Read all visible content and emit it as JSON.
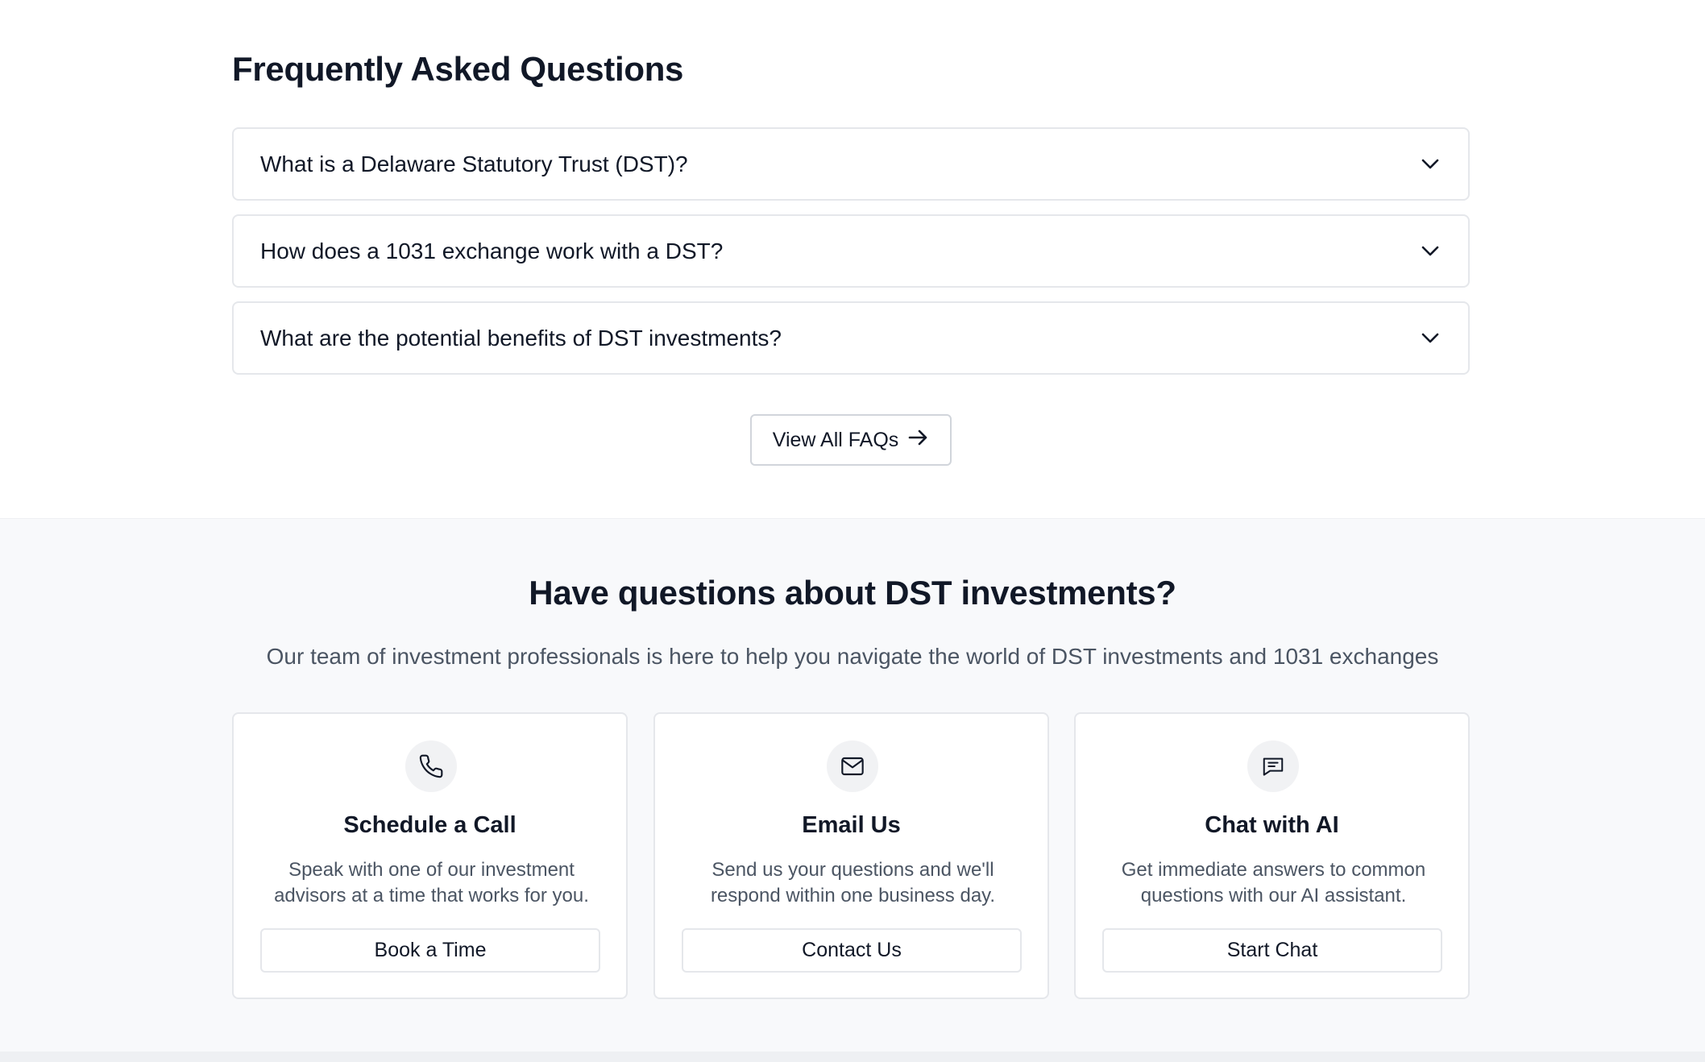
{
  "faq": {
    "title": "Frequently Asked Questions",
    "items": [
      {
        "question": "What is a Delaware Statutory Trust (DST)?",
        "icon": "chevron-down-icon"
      },
      {
        "question": "How does a 1031 exchange work with a DST?",
        "icon": "chevron-down-icon"
      },
      {
        "question": "What are the potential benefits of DST investments?",
        "icon": "chevron-down-icon"
      }
    ],
    "view_all_label": "View All FAQs",
    "view_all_icon": "arrow-right-icon"
  },
  "contact": {
    "title": "Have questions about DST investments?",
    "subtitle": "Our team of investment professionals is here to help you navigate the world of DST investments and 1031 exchanges",
    "cards": [
      {
        "icon": "phone-icon",
        "title": "Schedule a Call",
        "description": "Speak with one of our investment advisors at a time that works for you.",
        "button": "Book a Time"
      },
      {
        "icon": "mail-icon",
        "title": "Email Us",
        "description": "Send us your questions and we'll respond within one business day.",
        "button": "Contact Us"
      },
      {
        "icon": "chat-icon",
        "title": "Chat with AI",
        "description": "Get immediate answers to common questions with our AI assistant.",
        "button": "Start Chat"
      }
    ]
  },
  "colors": {
    "text_primary": "#111827",
    "text_secondary": "#4b5563",
    "border": "#e5e7eb",
    "section_bg": "#f8f9fb",
    "icon_bg": "#f1f2f4"
  }
}
